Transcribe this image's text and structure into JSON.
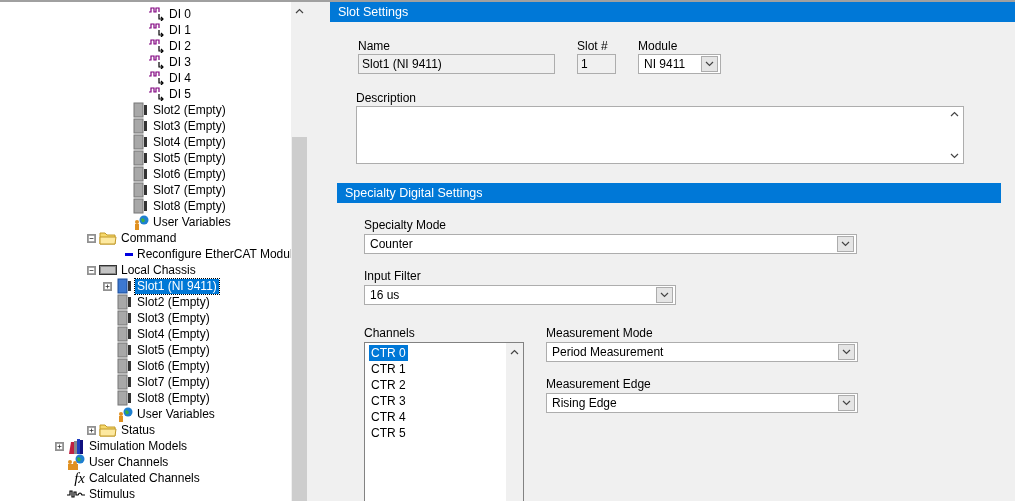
{
  "tree": {
    "items": [
      {
        "children": [
          {
            "children": [
              {
                "children": [
                  {
                    "children": [
                      {
                        "children": [
                          {
                            "label": "DI 0",
                            "kind": "di",
                            "selected": false
                          },
                          {
                            "label": "DI 1",
                            "kind": "di",
                            "selected": false
                          },
                          {
                            "label": "DI 2",
                            "kind": "di",
                            "selected": false
                          },
                          {
                            "label": "DI 3",
                            "kind": "di",
                            "selected": false
                          },
                          {
                            "label": "DI 4",
                            "kind": "di",
                            "selected": false
                          },
                          {
                            "label": "DI 5",
                            "kind": "di",
                            "selected": false
                          }
                        ]
                      },
                      {
                        "label": "Slot2 (Empty)",
                        "kind": "slot",
                        "selected": false
                      },
                      {
                        "label": "Slot3 (Empty)",
                        "kind": "slot",
                        "selected": false
                      },
                      {
                        "label": "Slot4 (Empty)",
                        "kind": "slot",
                        "selected": false
                      },
                      {
                        "label": "Slot5 (Empty)",
                        "kind": "slot",
                        "selected": false
                      },
                      {
                        "label": "Slot6 (Empty)",
                        "kind": "slot",
                        "selected": false
                      },
                      {
                        "label": "Slot7 (Empty)",
                        "kind": "slot",
                        "selected": false
                      },
                      {
                        "label": "Slot8 (Empty)",
                        "kind": "slot",
                        "selected": false
                      },
                      {
                        "label": "User Variables",
                        "kind": "uservars",
                        "selected": false
                      }
                    ]
                  }
                ]
              },
              {
                "label": "Command",
                "kind": "folder",
                "selected": false,
                "expanded": true,
                "children": [
                  {
                    "label": "Reconfigure EtherCAT Modul",
                    "kind": "command",
                    "selected": false
                  }
                ]
              },
              {
                "label": "Local Chassis",
                "kind": "chassis",
                "selected": false,
                "expanded": true,
                "children": [
                  {
                    "label": "Slot1 (NI 9411)",
                    "kind": "slot",
                    "selected": true,
                    "expanded": false
                  },
                  {
                    "label": "Slot2 (Empty)",
                    "kind": "slot",
                    "selected": false
                  },
                  {
                    "label": "Slot3 (Empty)",
                    "kind": "slot",
                    "selected": false
                  },
                  {
                    "label": "Slot4 (Empty)",
                    "kind": "slot",
                    "selected": false
                  },
                  {
                    "label": "Slot5 (Empty)",
                    "kind": "slot",
                    "selected": false
                  },
                  {
                    "label": "Slot6 (Empty)",
                    "kind": "slot",
                    "selected": false
                  },
                  {
                    "label": "Slot7 (Empty)",
                    "kind": "slot",
                    "selected": false
                  },
                  {
                    "label": "Slot8 (Empty)",
                    "kind": "slot",
                    "selected": false
                  },
                  {
                    "label": "User Variables",
                    "kind": "uservars",
                    "selected": false
                  }
                ]
              },
              {
                "label": "Status",
                "kind": "folder",
                "selected": false,
                "expanded": false
              }
            ]
          }
        ]
      },
      {
        "label": "Simulation Models",
        "kind": "models",
        "selected": false,
        "expanded": false
      },
      {
        "label": "User Channels",
        "kind": "channels",
        "selected": false
      },
      {
        "label": "Calculated Channels",
        "kind": "formula",
        "icon": "fx",
        "selected": false
      },
      {
        "label": "Stimulus",
        "kind": "stimulus",
        "selected": false
      }
    ]
  },
  "slot_settings": {
    "title": "Slot Settings",
    "name": {
      "label": "Name",
      "value": "Slot1 (NI 9411)",
      "disabled": true
    },
    "slot_number": {
      "label": "Slot #",
      "value": "1",
      "disabled": true
    },
    "module": {
      "label": "Module",
      "value": "NI 9411"
    },
    "description": {
      "label": "Description"
    }
  },
  "specialty_digital_settings": {
    "title": "Specialty Digital Settings",
    "specialty_mode": {
      "label": "Specialty Mode",
      "value": "Counter"
    },
    "input_filter": {
      "label": "Input Filter",
      "value": "16 us"
    },
    "channels": {
      "label": "Channels",
      "items": [
        {
          "label": "CTR 0",
          "selected": true
        },
        {
          "label": "CTR 1",
          "selected": false
        },
        {
          "label": "CTR 2",
          "selected": false
        },
        {
          "label": "CTR 3",
          "selected": false
        },
        {
          "label": "CTR 4",
          "selected": false
        },
        {
          "label": "CTR 5",
          "selected": false
        }
      ]
    },
    "measurement_mode": {
      "label": "Measurement Mode",
      "value": "Period Measurement"
    },
    "measurement_edge": {
      "label": "Measurement Edge",
      "value": "Rising Edge"
    }
  }
}
